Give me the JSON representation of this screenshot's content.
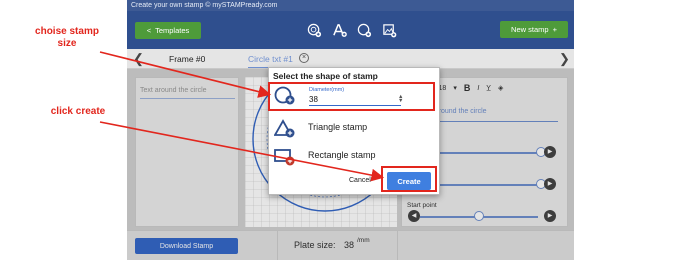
{
  "app": {
    "window_title": "Create your own stamp © mySTAMPready.com",
    "templates_label": "Templates",
    "new_stamp_label": "New stamp",
    "tabs": [
      {
        "label": "Frame #0"
      },
      {
        "label": "Circle txt #1"
      }
    ],
    "left_panel_placeholder": "Text around the circle",
    "right_panel": {
      "font_size": "18",
      "bold": "B",
      "italic": "I",
      "text_placeholder": "Text around the circle",
      "start_point_label": "Start point",
      "slider_levels": [
        1.0,
        1.0,
        0.45
      ]
    },
    "download_label": "Download Stamp",
    "plate_size_label": "Plate size:",
    "plate_size_value": "38",
    "plate_size_unit": "/mm"
  },
  "dialog": {
    "title": "Select the shape of stamp",
    "diameter_label": "Diameter(mm)",
    "diameter_value": "38",
    "triangle_label": "Triangle stamp",
    "rectangle_label": "Rectangle stamp",
    "cancel_label": "Cancel",
    "create_label": "Create"
  },
  "annotations": {
    "size_note": "choise stamp size",
    "create_note": "click create",
    "color": "#e2261d"
  },
  "colors": {
    "toolbar": "#2f4f8e",
    "green_button": "#4e9b3a",
    "create_button": "#3f7fe0",
    "accent": "#3568c9"
  }
}
